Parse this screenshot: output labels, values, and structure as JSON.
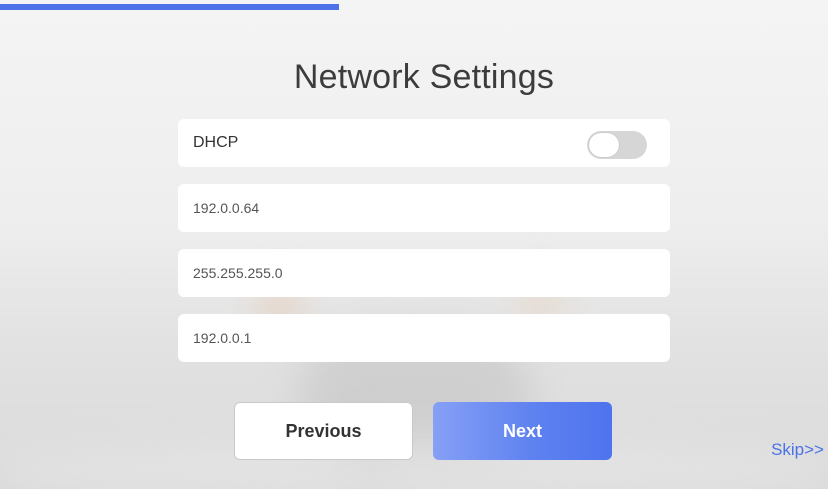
{
  "progress": {
    "fraction": 0.41,
    "color": "#4f72e8"
  },
  "page": {
    "title": "Network Settings"
  },
  "dhcp": {
    "label": "DHCP",
    "enabled": false
  },
  "fields": {
    "ip_address": "192.0.0.64",
    "subnet_mask": "255.255.255.0",
    "gateway": "192.0.0.1"
  },
  "buttons": {
    "previous": "Previous",
    "next": "Next",
    "skip": "Skip>>"
  },
  "colors": {
    "accent": "#4f72e8",
    "next_gradient_start": "#86a0f6",
    "next_gradient_end": "#4e73ee"
  }
}
